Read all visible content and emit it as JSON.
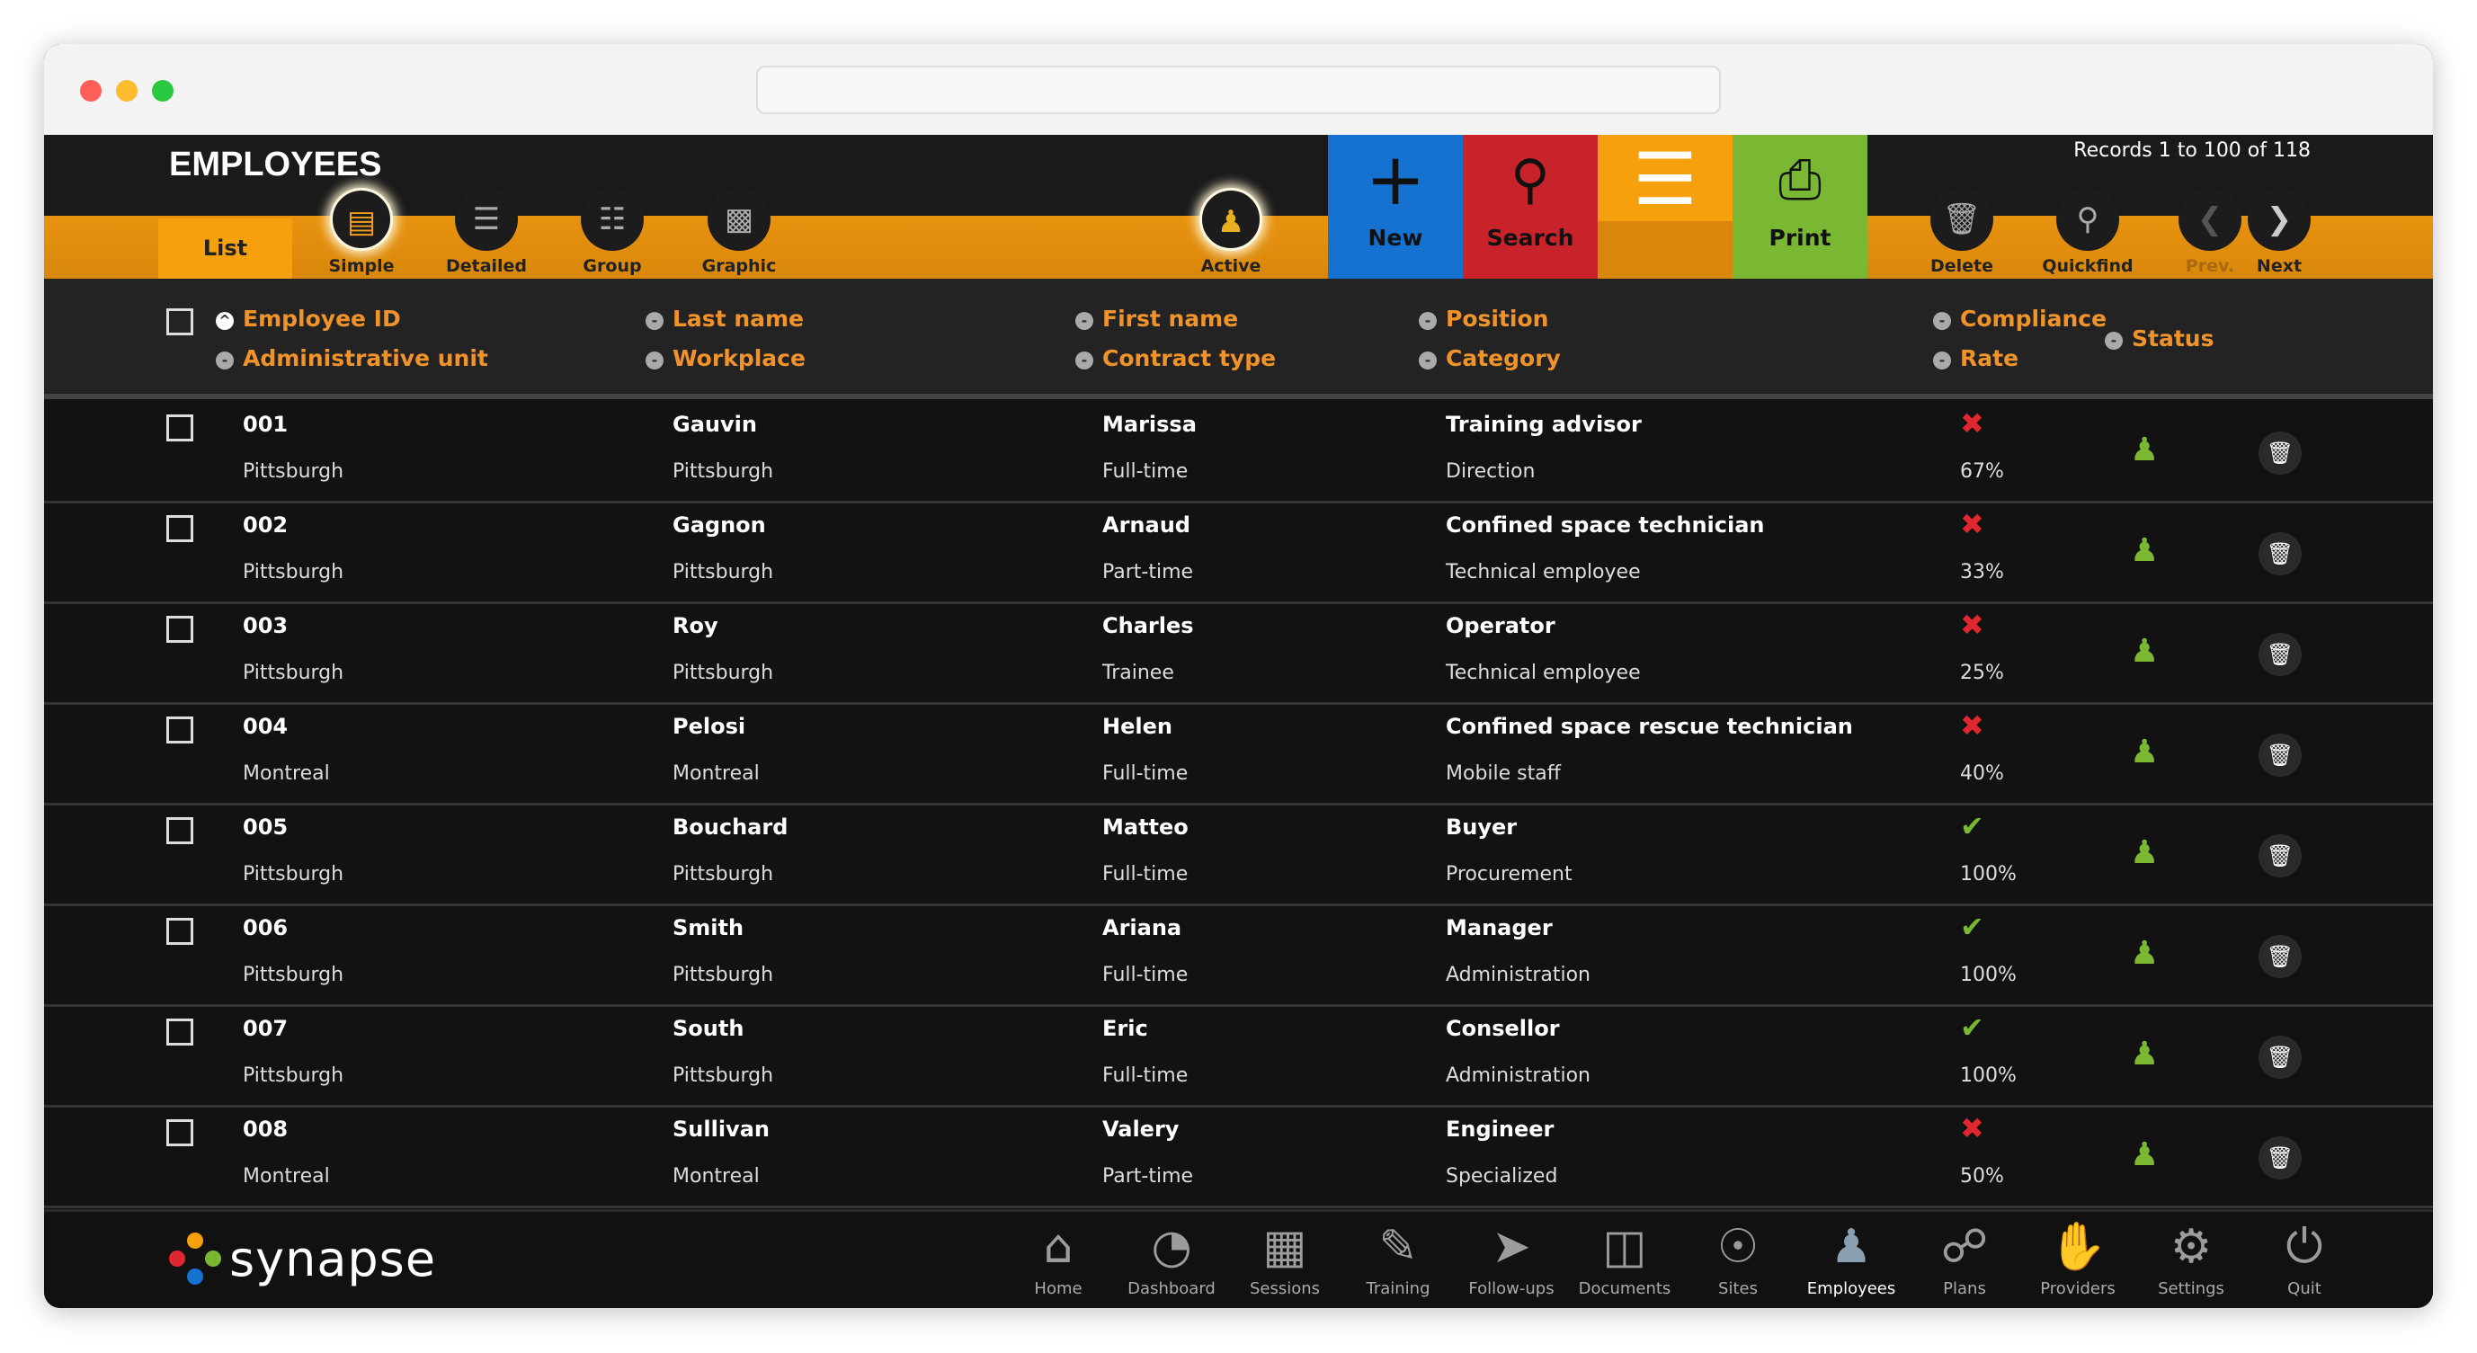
{
  "page": {
    "title": "EMPLOYEES",
    "records": "Records 1 to 100 of 118"
  },
  "colors": {
    "orange": "#e8930f",
    "new": "#1672d0",
    "search": "#c8232b",
    "menu": "#f7a00d",
    "print": "#7ab833",
    "header_text": "#f0932a",
    "ok": "#7ab833",
    "fail": "#e0262e"
  },
  "toolbar": {
    "list": "List",
    "views": [
      {
        "label": "Simple",
        "icon": "simple-list-icon",
        "active": true
      },
      {
        "label": "Detailed",
        "icon": "detailed-list-icon"
      },
      {
        "label": "Group",
        "icon": "group-list-icon"
      },
      {
        "label": "Graphic",
        "icon": "chart-icon"
      }
    ],
    "active": "Active",
    "new": "New",
    "search": "Search",
    "print": "Print",
    "delete": "Delete",
    "quickfind": "Quickfind",
    "prev": "Prev.",
    "next": "Next"
  },
  "columns": {
    "id": "Employee ID",
    "unit": "Administrative unit",
    "last": "Last name",
    "workplace": "Workplace",
    "first": "First name",
    "contract": "Contract type",
    "position": "Position",
    "category": "Category",
    "compliance": "Compliance",
    "rate": "Rate",
    "status": "Status"
  },
  "rows": [
    {
      "id": "001",
      "unit": "Pittsburgh",
      "last": "Gauvin",
      "workplace": "Pittsburgh",
      "first": "Marissa",
      "contract": "Full-time",
      "position": "Training advisor",
      "category": "Direction",
      "compliant": false,
      "rate": "67%"
    },
    {
      "id": "002",
      "unit": "Pittsburgh",
      "last": "Gagnon",
      "workplace": "Pittsburgh",
      "first": "Arnaud",
      "contract": "Part-time",
      "position": "Confined space technician",
      "category": "Technical employee",
      "compliant": false,
      "rate": "33%"
    },
    {
      "id": "003",
      "unit": "Pittsburgh",
      "last": "Roy",
      "workplace": "Pittsburgh",
      "first": "Charles",
      "contract": "Trainee",
      "position": "Operator",
      "category": "Technical employee",
      "compliant": false,
      "rate": "25%"
    },
    {
      "id": "004",
      "unit": "Montreal",
      "last": "Pelosi",
      "workplace": "Montreal",
      "first": "Helen",
      "contract": "Full-time",
      "position": "Confined space rescue technician",
      "category": "Mobile staff",
      "compliant": false,
      "rate": "40%"
    },
    {
      "id": "005",
      "unit": "Pittsburgh",
      "last": "Bouchard",
      "workplace": "Pittsburgh",
      "first": "Matteo",
      "contract": "Full-time",
      "position": "Buyer",
      "category": "Procurement",
      "compliant": true,
      "rate": "100%"
    },
    {
      "id": "006",
      "unit": "Pittsburgh",
      "last": "Smith",
      "workplace": "Pittsburgh",
      "first": "Ariana",
      "contract": "Full-time",
      "position": "Manager",
      "category": "Administration",
      "compliant": true,
      "rate": "100%"
    },
    {
      "id": "007",
      "unit": "Pittsburgh",
      "last": "South",
      "workplace": "Pittsburgh",
      "first": "Eric",
      "contract": "Full-time",
      "position": "Consellor",
      "category": "Administration",
      "compliant": true,
      "rate": "100%"
    },
    {
      "id": "008",
      "unit": "Montreal",
      "last": "Sullivan",
      "workplace": "Montreal",
      "first": "Valery",
      "contract": "Part-time",
      "position": "Engineer",
      "category": "Specialized",
      "compliant": false,
      "rate": "50%"
    }
  ],
  "footer": {
    "logo": "synapse",
    "nav": [
      {
        "label": "Home",
        "icon": "home-icon"
      },
      {
        "label": "Dashboard",
        "icon": "dashboard-icon"
      },
      {
        "label": "Sessions",
        "icon": "calendar-icon"
      },
      {
        "label": "Training",
        "icon": "diploma-icon"
      },
      {
        "label": "Follow-ups",
        "icon": "paper-plane-icon"
      },
      {
        "label": "Documents",
        "icon": "folder-icon"
      },
      {
        "label": "Sites",
        "icon": "globe-icon"
      },
      {
        "label": "Employees",
        "icon": "worker-icon",
        "active": true
      },
      {
        "label": "Plans",
        "icon": "share-icon"
      },
      {
        "label": "Providers",
        "icon": "handshake-icon"
      },
      {
        "label": "Settings",
        "icon": "gear-icon"
      },
      {
        "label": "Quit",
        "icon": "power-icon"
      }
    ]
  }
}
